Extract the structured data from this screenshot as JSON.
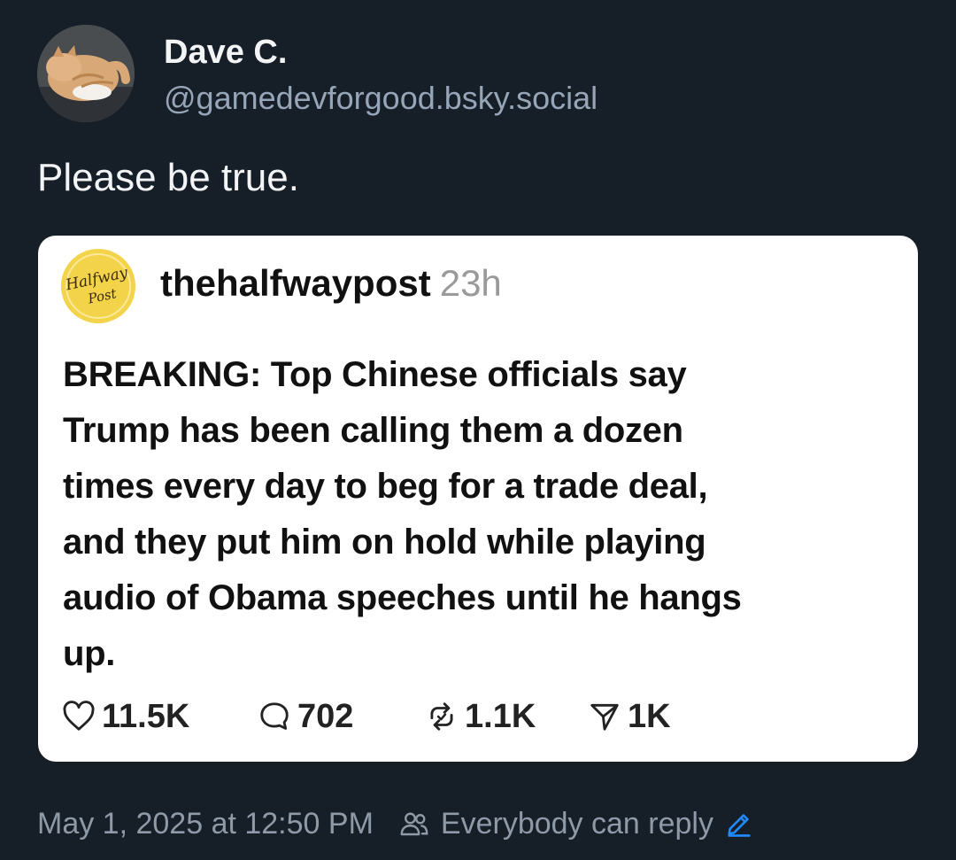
{
  "author": {
    "display_name": "Dave C.",
    "handle": "@gamedevforgood.bsky.social",
    "avatar_icon": "cat-avatar"
  },
  "post": {
    "text": "Please be true."
  },
  "quote": {
    "author": "thehalfwaypost",
    "time": "23h",
    "avatar_logo_text": "Halfway Post",
    "body_lines": [
      "BREAKING: Top Chinese officials say",
      "Trump has been calling them a dozen",
      "times every day to beg for a trade deal,",
      "and they put him on hold while playing",
      "audio of Obama speeches until he hangs",
      "up."
    ],
    "stats": {
      "likes": "11.5K",
      "comments": "702",
      "reposts": "1.1K",
      "shares": "1K"
    }
  },
  "footer": {
    "timestamp": "May 1, 2025 at 12:50 PM",
    "reply_setting": "Everybody can reply"
  },
  "colors": {
    "background": "#161e27",
    "handle": "#96a6b8",
    "footer_text": "#8e9aa8",
    "accent_edit": "#208bfe",
    "logo_yellow": "#f2d34a"
  }
}
